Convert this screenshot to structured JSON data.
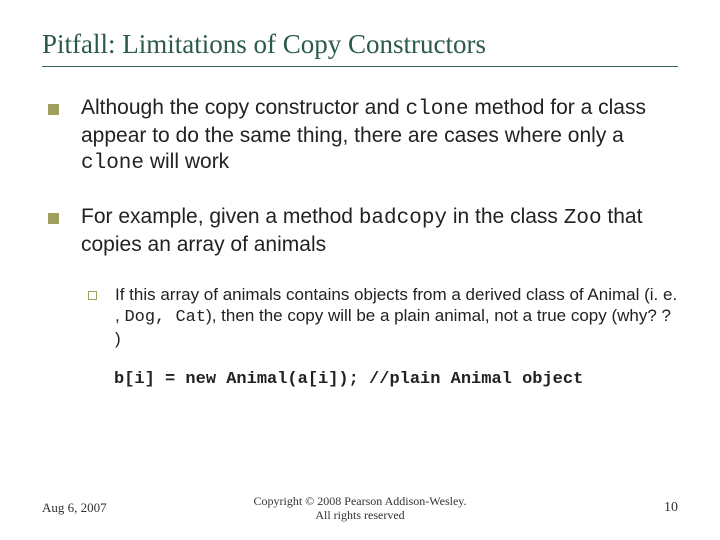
{
  "title": "Pitfall:  Limitations of Copy Constructors",
  "bullets": [
    {
      "pre1": "Although the copy constructor and ",
      "code1": "clone",
      "mid1": " method for a class appear to do the same thing, there are cases where only a ",
      "code2": "clone",
      "post1": " will work"
    },
    {
      "pre1": "For example, given a method ",
      "code1": "badcopy",
      "mid1": " in the class ",
      "code2": "Zoo",
      "post1": " that copies an array of animals"
    }
  ],
  "sub": {
    "pre": "If this array of animals contains objects from a derived class of Animal (i. e. , ",
    "code": "Dog, Cat",
    "post": "), then the copy will be a plain animal, not a true copy (why? ? )"
  },
  "codeline": "b[i] = new Animal(a[i]); //plain Animal object",
  "footer": {
    "date": "Aug 6, 2007",
    "copyright1": "Copyright © 2008 Pearson Addison-Wesley.",
    "copyright2": "All rights reserved",
    "page": "10"
  }
}
